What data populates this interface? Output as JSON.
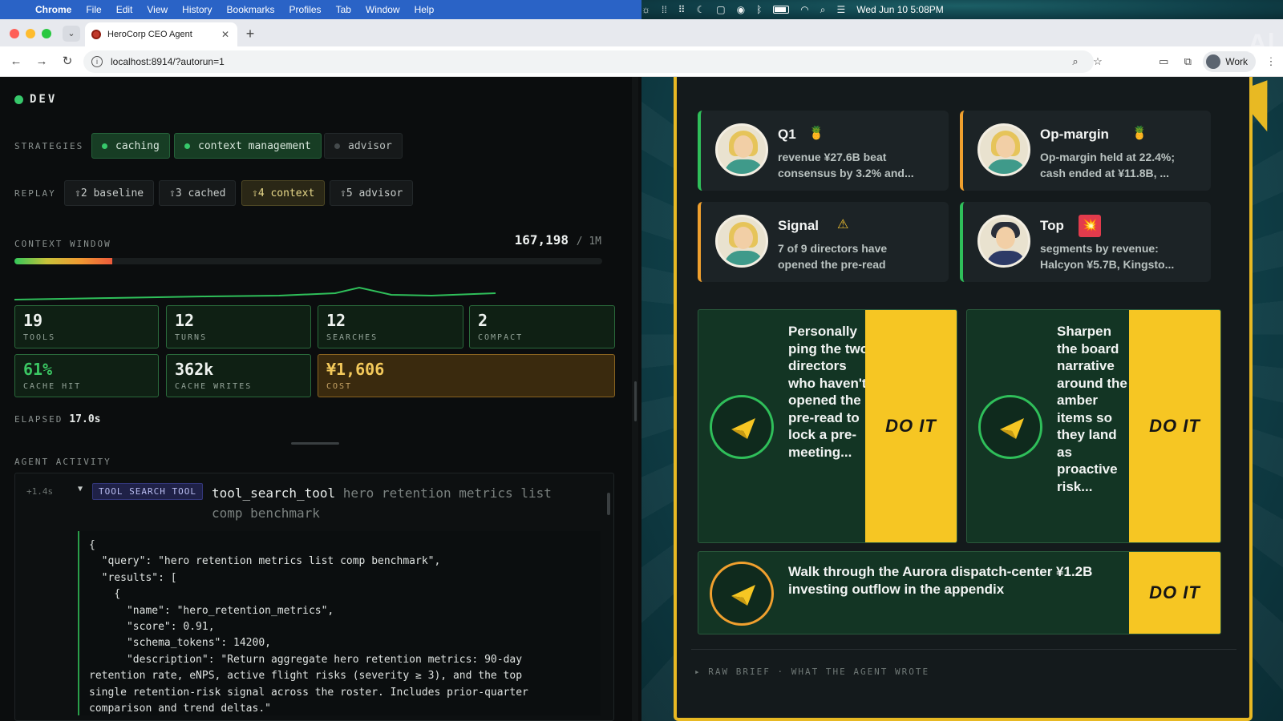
{
  "menubar": {
    "app": "Chrome",
    "items": [
      "File",
      "Edit",
      "View",
      "History",
      "Bookmarks",
      "Profiles",
      "Tab",
      "Window",
      "Help"
    ],
    "clock": "Wed Jun 10  5:08PM"
  },
  "browser": {
    "tab_title": "HeroCorp CEO Agent",
    "url": "localhost:8914/?autorun=1",
    "profile": "Work"
  },
  "dev_panel": {
    "env": "DEV",
    "strategies_label": "STRATEGIES",
    "strategies": [
      {
        "label": "caching",
        "on": true
      },
      {
        "label": "context management",
        "on": true
      },
      {
        "label": "advisor",
        "on": false
      }
    ],
    "replay_label": "REPLAY",
    "replay": [
      {
        "label": "⇧2 baseline",
        "active": false
      },
      {
        "label": "⇧3 cached",
        "active": false
      },
      {
        "label": "⇧4 context",
        "active": true
      },
      {
        "label": "⇧5 advisor",
        "active": false
      }
    ],
    "context_window_label": "CONTEXT WINDOW",
    "context_used": "167,198",
    "context_max": "/ 1M",
    "context_fill_fraction": 0.167,
    "stats": [
      {
        "value": "19",
        "label": "TOOLS"
      },
      {
        "value": "12",
        "label": "TURNS"
      },
      {
        "value": "12",
        "label": "SEARCHES"
      },
      {
        "value": "2",
        "label": "COMPACT"
      },
      {
        "value": "61%",
        "label": "CACHE HIT"
      },
      {
        "value": "362k",
        "label": "CACHE WRITES"
      },
      {
        "value": "¥1,606",
        "label": "COST"
      }
    ],
    "elapsed_label": "ELAPSED",
    "elapsed": "17.0s",
    "activity_label": "AGENT ACTIVITY",
    "activity": {
      "time": "+1.4s",
      "badge": "TOOL SEARCH TOOL",
      "tool": "tool_search_tool",
      "query": "hero retention metrics list comp benchmark",
      "json": "{\n  \"query\": \"hero retention metrics list comp benchmark\",\n  \"results\": [\n    {\n      \"name\": \"hero_retention_metrics\",\n      \"score\": 0.91,\n      \"schema_tokens\": 14200,\n      \"description\": \"Return aggregate hero retention metrics: 90-day\nretention rate, eNPS, active flight risks (severity ≥ 3), and the top\nsingle retention-risk signal across the roster. Includes prior-quarter\ncomparison and trend deltas.\""
    }
  },
  "brief": {
    "kpis": [
      {
        "title": "Q1",
        "icon": "🍍",
        "line1": "revenue ¥27.6B beat",
        "line2": "consensus by 3.2% and...",
        "accent": "green"
      },
      {
        "title": "Op-margin",
        "icon": "🍍",
        "line1": "Op-margin held at 22.4%;",
        "line2": "cash ended at ¥11.8B, ...",
        "accent": "amber"
      },
      {
        "title": "Signal",
        "icon": "⚠",
        "line1": "7 of 9 directors have",
        "line2": "opened the pre-read",
        "accent": "amber"
      },
      {
        "title": "Top",
        "icon": "💥",
        "line1": "segments by revenue:",
        "line2": "Halcyon ¥5.7B, Kingsto...",
        "accent": "green"
      }
    ],
    "actions": [
      {
        "text": "Personally ping the two directors who haven't opened the pre-read to lock a pre-meeting...",
        "cta": "DO IT"
      },
      {
        "text": "Sharpen the board narrative around the amber items so they land as proactive risk...",
        "cta": "DO IT"
      },
      {
        "text": "Walk through the Aurora dispatch-center ¥1.2B investing outflow in the appendix",
        "cta": "DO IT"
      }
    ],
    "raw_brief": "▸ RAW BRIEF · WHAT THE AGENT WROTE"
  }
}
